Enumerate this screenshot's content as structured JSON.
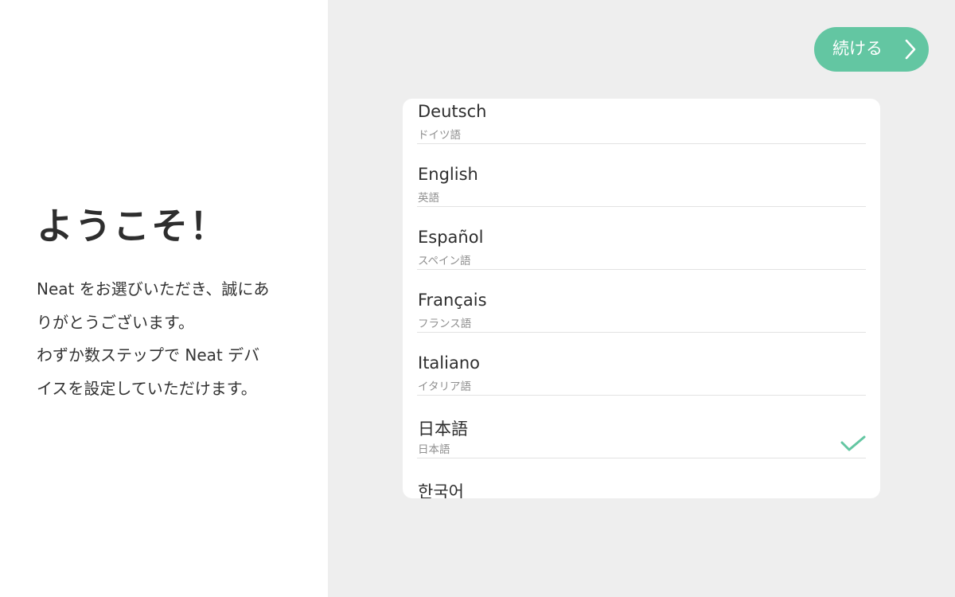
{
  "welcome": {
    "title": "ようこそ！",
    "body_lines": [
      "Neat をお選びいただき、誠にあ",
      "りがとうございます。",
      "わずか数ステップで Neat デバ",
      "イスを設定していただけます。"
    ]
  },
  "continue_button": {
    "label": "続ける",
    "icon": "chevron-right-icon"
  },
  "languages": [
    {
      "native": "Deutsch",
      "local": "ドイツ語",
      "selected": false
    },
    {
      "native": "English",
      "local": "英語",
      "selected": false
    },
    {
      "native": "Español",
      "local": "スペイン語",
      "selected": false
    },
    {
      "native": "Français",
      "local": "フランス語",
      "selected": false
    },
    {
      "native": "Italiano",
      "local": "イタリア語",
      "selected": false
    },
    {
      "native": "日本語",
      "local": "日本語",
      "selected": true
    },
    {
      "native": "한국어",
      "local": "",
      "selected": false
    }
  ],
  "colors": {
    "accent": "#63c6a2",
    "left_background": "#ffffff",
    "right_background": "#eeeeee",
    "card_background": "#ffffff",
    "primary_text": "#2e2e2e",
    "secondary_text": "#8f8f8f",
    "divider": "#e2e2e2"
  },
  "icons": {
    "selected_marker": "check-icon"
  }
}
